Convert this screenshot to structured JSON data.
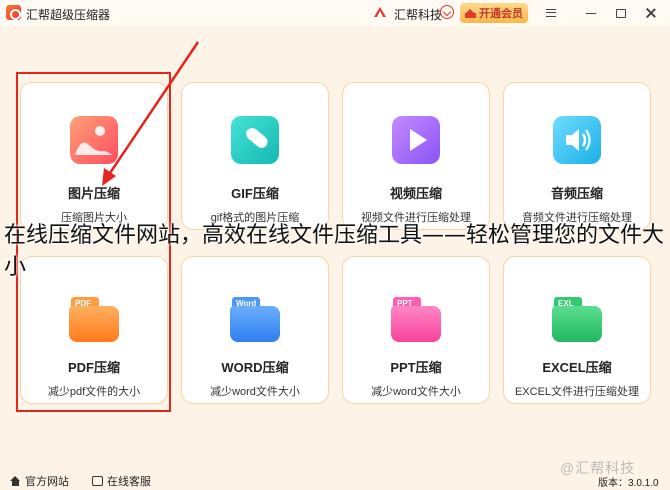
{
  "app": {
    "title": "汇帮超级压缩器",
    "brand": "汇帮科技",
    "vip_label": "开通会员"
  },
  "cards_row1": [
    {
      "name": "图片压缩",
      "desc": "压缩图片大小"
    },
    {
      "name": "GIF压缩",
      "desc": "gif格式的图片压缩"
    },
    {
      "name": "视频压缩",
      "desc": "视频文件进行压缩处理"
    },
    {
      "name": "音频压缩",
      "desc": "音频文件进行压缩处理"
    }
  ],
  "cards_row2": [
    {
      "name": "PDF压缩",
      "desc": "减少pdf文件的大小",
      "tag": "PDF"
    },
    {
      "name": "WORD压缩",
      "desc": "减少word文件大小",
      "tag": "Word"
    },
    {
      "name": "PPT压缩",
      "desc": "减少word文件大小",
      "tag": "PPT"
    },
    {
      "name": "EXCEL压缩",
      "desc": "EXCEL文件进行压缩处理",
      "tag": "EXL"
    }
  ],
  "overlay_caption": "在线压缩文件网站，高效在线文件压缩工具——轻松管理您的文件大小",
  "statusbar": {
    "website": "官方网站",
    "service": "在线客服",
    "version": "版本：3.0.1.0"
  },
  "watermark": "@汇帮科技",
  "colors": {
    "image": "#ff6b5c",
    "gif": "#1fd0c4",
    "video": "#a86bff",
    "audio": "#34c9f0",
    "pdf": "#ff8b2a",
    "word": "#3c8cf5",
    "ppt": "#ff4fa8",
    "excel": "#2fca6e",
    "accent_red": "#e3261e"
  }
}
